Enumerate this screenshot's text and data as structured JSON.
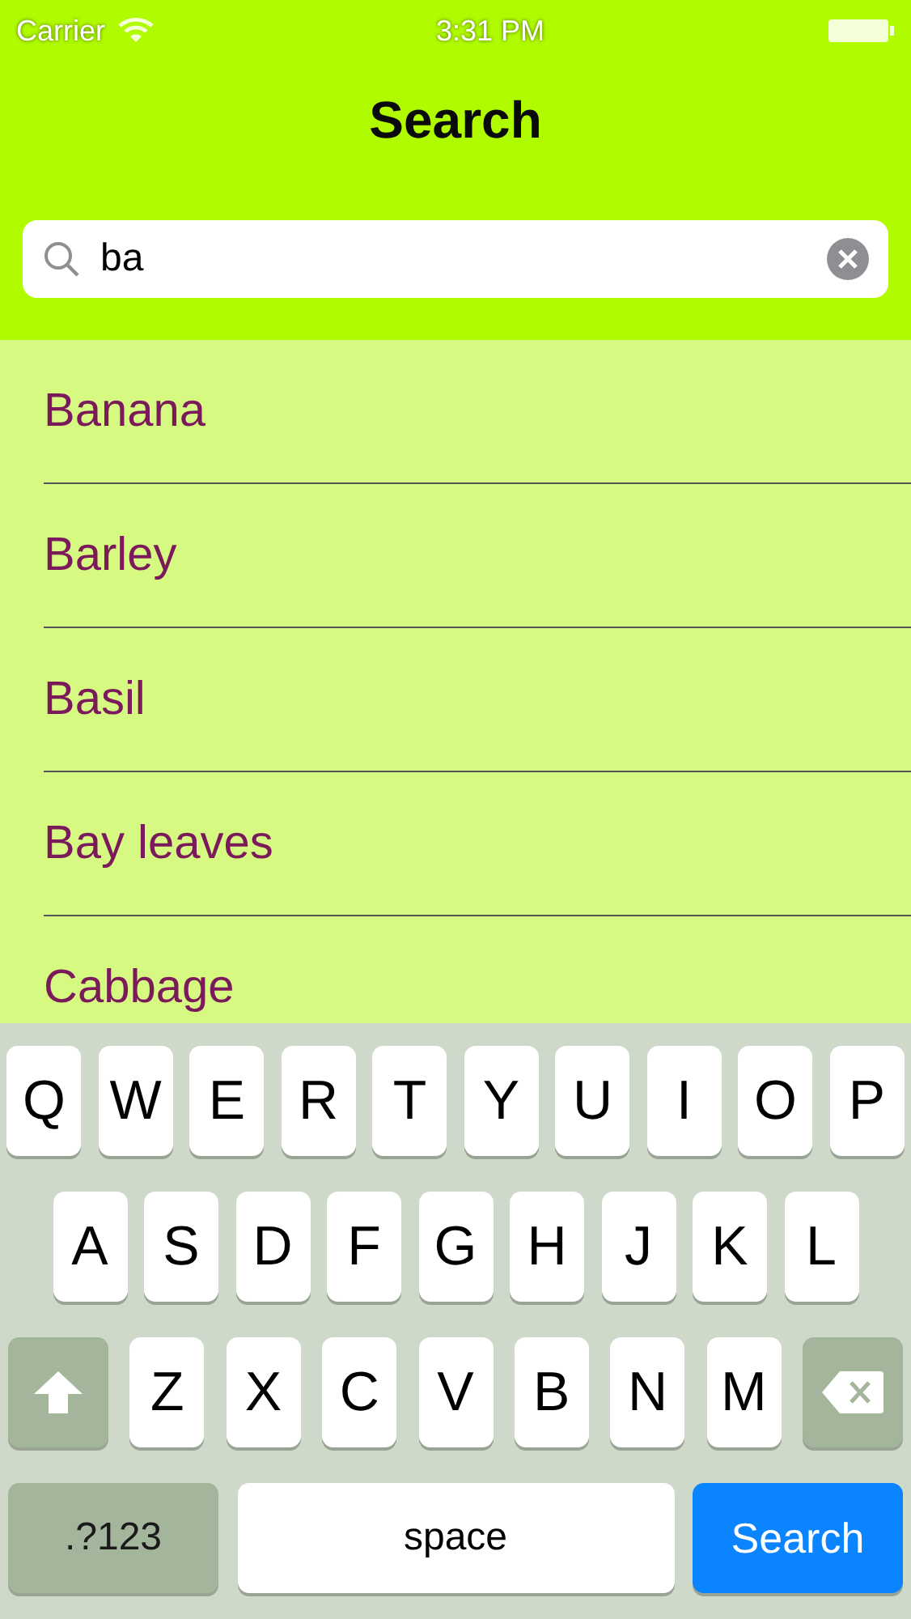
{
  "status_bar": {
    "carrier": "Carrier",
    "time": "3:31 PM"
  },
  "nav": {
    "title": "Search"
  },
  "search": {
    "value": "ba"
  },
  "results": [
    {
      "label": "Banana"
    },
    {
      "label": "Barley"
    },
    {
      "label": "Basil"
    },
    {
      "label": "Bay leaves"
    },
    {
      "label": "Cabbage"
    }
  ],
  "keyboard": {
    "top_row": [
      {
        "kind": "letter",
        "label": "Q"
      },
      {
        "kind": "letter",
        "label": "W"
      },
      {
        "kind": "letter",
        "label": "E"
      },
      {
        "kind": "letter",
        "label": "R"
      },
      {
        "kind": "letter",
        "label": "T"
      },
      {
        "kind": "letter",
        "label": "Y"
      },
      {
        "kind": "letter",
        "label": "U"
      },
      {
        "kind": "letter",
        "label": "I"
      },
      {
        "kind": "letter",
        "label": "O"
      },
      {
        "kind": "letter",
        "label": "P"
      }
    ],
    "middle_row": [
      {
        "kind": "letter",
        "label": "A"
      },
      {
        "kind": "letter",
        "label": "S"
      },
      {
        "kind": "letter",
        "label": "D"
      },
      {
        "kind": "letter",
        "label": "F"
      },
      {
        "kind": "letter",
        "label": "G"
      },
      {
        "kind": "letter",
        "label": "H"
      },
      {
        "kind": "letter",
        "label": "J"
      },
      {
        "kind": "letter",
        "label": "K"
      },
      {
        "kind": "letter",
        "label": "L"
      }
    ],
    "bottom_row": [
      {
        "kind": "shift"
      },
      {
        "kind": "letter",
        "label": "Z"
      },
      {
        "kind": "letter",
        "label": "X"
      },
      {
        "kind": "letter",
        "label": "C"
      },
      {
        "kind": "letter",
        "label": "V"
      },
      {
        "kind": "letter",
        "label": "B"
      },
      {
        "kind": "letter",
        "label": "N"
      },
      {
        "kind": "letter",
        "label": "M"
      },
      {
        "kind": "delete"
      }
    ],
    "function_row": [
      {
        "kind": "mode",
        "label": ".?123"
      },
      {
        "kind": "space",
        "label": "space"
      },
      {
        "kind": "action",
        "label": "Search"
      }
    ]
  }
}
